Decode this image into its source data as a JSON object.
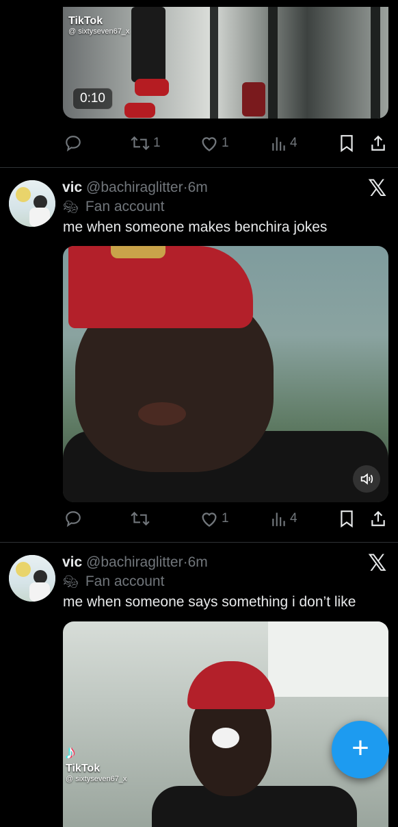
{
  "top_post": {
    "media": {
      "duration": "0:10",
      "watermark_name": "TikTok",
      "watermark_handle": "@ sixtyseven67_x"
    },
    "actions": {
      "reply": "",
      "repost": "1",
      "like": "1",
      "views": "4"
    }
  },
  "posts": [
    {
      "display_name": "vic",
      "handle_time": "@bachiraglitter·6m",
      "label": "Fan account",
      "text": "me when someone makes benchira jokes",
      "actions": {
        "reply": "",
        "repost": "",
        "like": "1",
        "views": "4"
      }
    },
    {
      "display_name": "vic",
      "handle_time": "@bachiraglitter·6m",
      "label": "Fan account",
      "text": "me when someone says something i don’t like",
      "media": {
        "watermark_name": "TikTok",
        "watermark_handle": "@ sixtyseven67_x"
      }
    }
  ],
  "icons": {
    "reply": "reply-icon",
    "repost": "repost-icon",
    "like": "like-icon",
    "views": "views-icon",
    "bookmark": "bookmark-icon",
    "share": "share-icon",
    "grok": "x-logo-icon",
    "fab": "compose-icon",
    "mute": "speaker-icon"
  },
  "fab": {
    "label": "+"
  },
  "colors": {
    "background": "#000000",
    "text": "#e7e9ea",
    "secondary": "#71767b",
    "accent": "#1d9bf0",
    "divider": "#2f3336"
  }
}
